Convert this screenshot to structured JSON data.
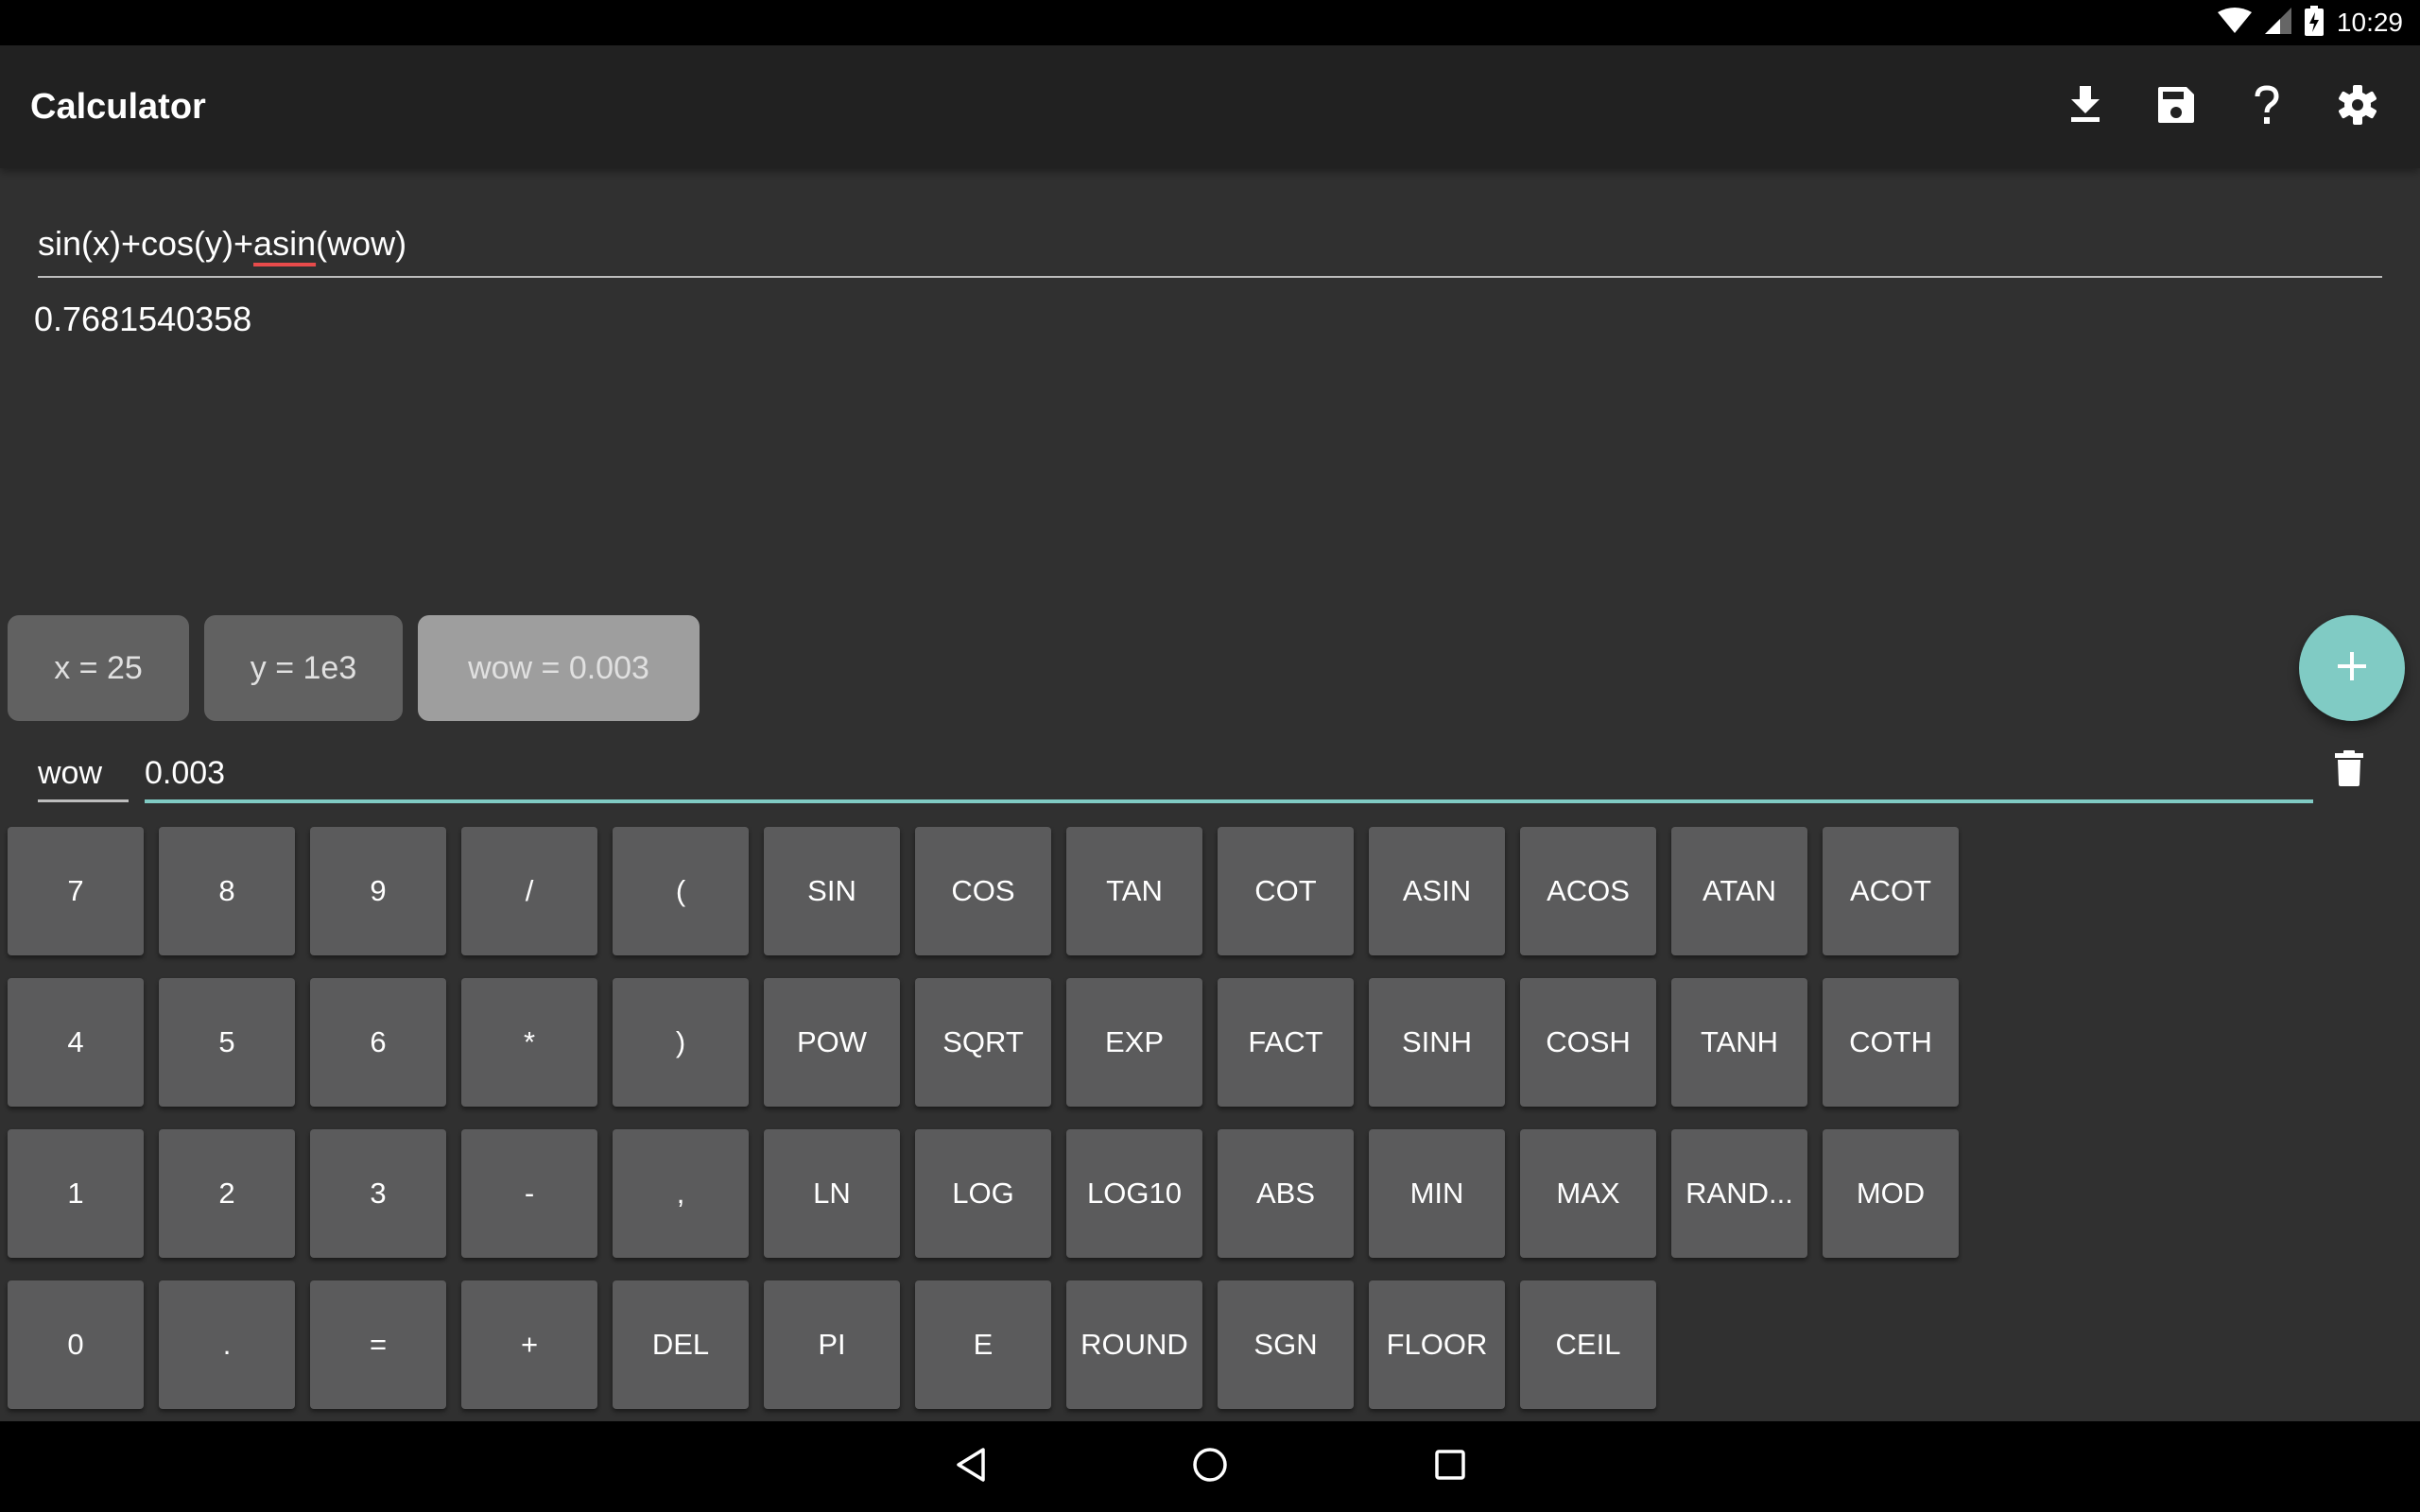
{
  "status_bar": {
    "time": "10:29",
    "icons": [
      "wifi-icon",
      "cell-signal-icon",
      "battery-charging-icon"
    ]
  },
  "app_bar": {
    "title": "Calculator",
    "actions": [
      {
        "name": "download-icon",
        "label": "Import"
      },
      {
        "name": "save-icon",
        "label": "Save"
      },
      {
        "name": "help-icon",
        "label": "Help"
      },
      {
        "name": "settings-icon",
        "label": "Settings"
      }
    ]
  },
  "expression": {
    "before_error": "sin(x)+cos(y)+",
    "error_word": "asin",
    "after_error": "(wow)"
  },
  "result": "0.7681540358",
  "variables": [
    {
      "label": "x = 25",
      "active": false
    },
    {
      "label": "y = 1e3",
      "active": false
    },
    {
      "label": "wow = 0.003",
      "active": true
    }
  ],
  "add_variable_icon": "plus-icon",
  "editor": {
    "name": "wow",
    "value": "0.003",
    "delete_icon": "trash-icon"
  },
  "keypad": {
    "rows": [
      [
        "7",
        "8",
        "9",
        "/",
        "(",
        "SIN",
        "COS",
        "TAN",
        "COT",
        "ASIN",
        "ACOS",
        "ATAN",
        "ACOT"
      ],
      [
        "4",
        "5",
        "6",
        "*",
        ")",
        "POW",
        "SQRT",
        "EXP",
        "FACT",
        "SINH",
        "COSH",
        "TANH",
        "COTH"
      ],
      [
        "1",
        "2",
        "3",
        "-",
        ",",
        "LN",
        "LOG",
        "LOG10",
        "ABS",
        "MIN",
        "MAX",
        "RAND...",
        "MOD"
      ],
      [
        "0",
        ".",
        "=",
        "+",
        "DEL",
        "PI",
        "E",
        "ROUND",
        "SGN",
        "FLOOR",
        "CEIL"
      ]
    ]
  },
  "colors": {
    "accent": "#80cbc4",
    "error_underline": "#e84b4b",
    "key_bg": "#5b5b5c",
    "app_bar": "#212121",
    "background": "#303030"
  },
  "nav_bar": {
    "buttons": [
      "back-icon",
      "home-icon",
      "recents-icon"
    ]
  }
}
